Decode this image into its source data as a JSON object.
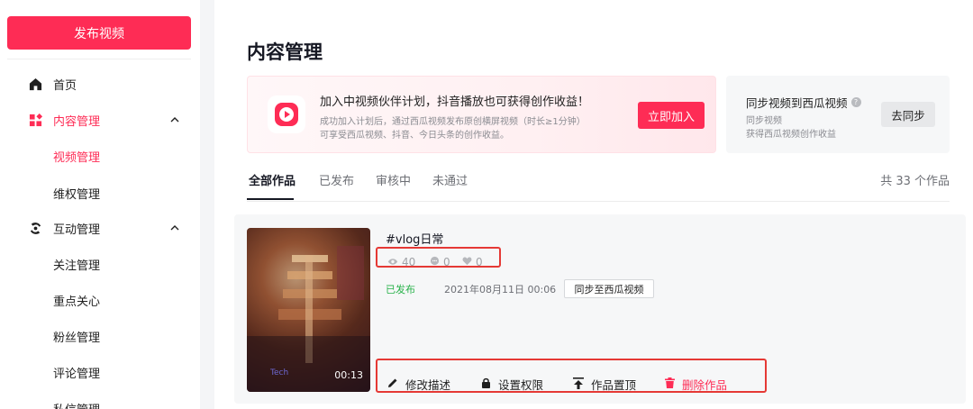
{
  "sidebar": {
    "publish_label": "发布视频",
    "items": [
      {
        "label": "首页"
      },
      {
        "label": "内容管理"
      },
      {
        "label": "视频管理"
      },
      {
        "label": "维权管理"
      },
      {
        "label": "互动管理"
      },
      {
        "label": "关注管理"
      },
      {
        "label": "重点关心"
      },
      {
        "label": "粉丝管理"
      },
      {
        "label": "评论管理"
      },
      {
        "label": "私信管理"
      }
    ]
  },
  "main": {
    "title": "内容管理",
    "promo": {
      "title": "加入中视频伙伴计划，抖音播放也可获得创作收益！",
      "desc1": "成功加入计划后，通过西瓜视频发布原创横屏视频（时长≥1分钟）",
      "desc2": "可享受西瓜视频、抖音、今日头条的创作收益。",
      "button": "立即加入"
    },
    "sync": {
      "title": "同步视频到西瓜视频",
      "desc1": "同步视频",
      "desc2": "获得西瓜视频创作收益",
      "button": "去同步"
    },
    "tabs": [
      {
        "label": "全部作品"
      },
      {
        "label": "已发布"
      },
      {
        "label": "审核中"
      },
      {
        "label": "未通过"
      }
    ],
    "total": "共 33 个作品",
    "work": {
      "title": "#vlog日常",
      "views": "40",
      "comments": "0",
      "likes": "0",
      "status": "已发布",
      "date": "2021年08月11日 00:06",
      "sync_label": "同步至西瓜视频",
      "duration": "00:13",
      "actions": {
        "edit": "修改描述",
        "permission": "设置权限",
        "pin": "作品置顶",
        "delete": "删除作品"
      }
    }
  },
  "colors": {
    "accent": "#fe2c55",
    "success": "#28b24a",
    "highlight_box": "#e53935"
  }
}
